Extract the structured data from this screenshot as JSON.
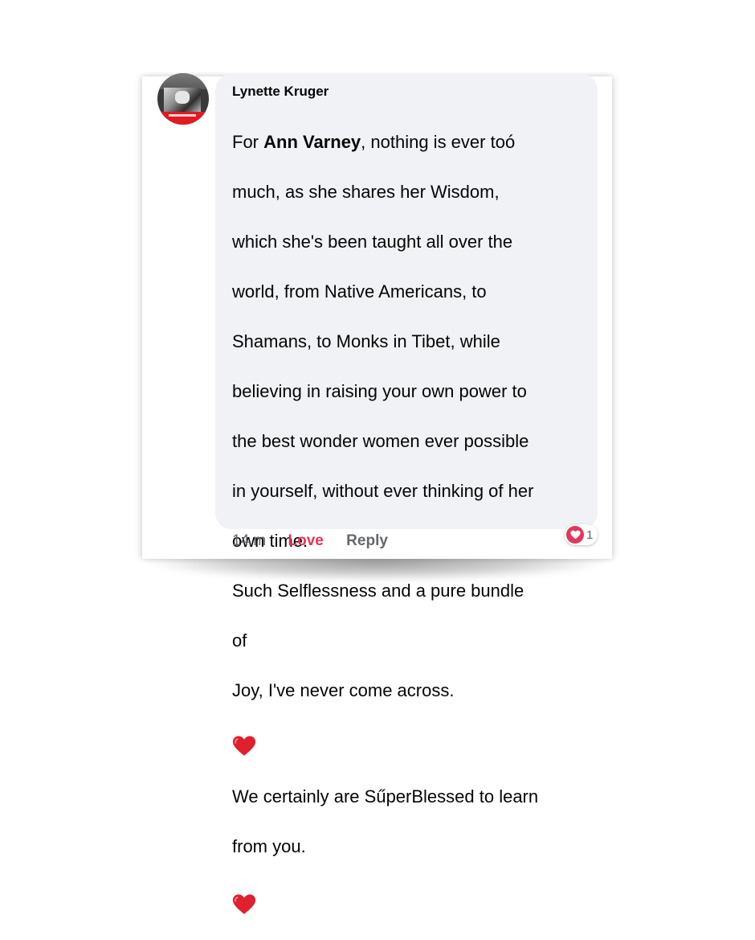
{
  "comment": {
    "author": "Lynette Kruger",
    "lines": [
      {
        "pre": "For ",
        "bold": "Ann Varney",
        "post": ", nothing is ever toó"
      },
      "much, as she shares her Wisdom,",
      "which she's been taught all over the",
      "world, from Native Americans, to",
      "Shamans, to Monks in Tibet, while",
      "believing in raising your own power to",
      "the best wonder women ever possible",
      "in yourself, without ever thinking of her",
      "own time.",
      "Such Selflessness and a pure bundle",
      "of",
      "Joy, I've never come across.",
      "We certainly are SűperBlessed to learn",
      "from you."
    ],
    "emoji": "red-heart"
  },
  "actions": {
    "time": "14 m",
    "love_label": "Love",
    "reply_label": "Reply"
  },
  "reaction": {
    "icon": "heart-reaction-icon",
    "count": "1"
  },
  "colors": {
    "bubble": "#f0f2f5",
    "love": "#e4365a",
    "heart": "#e0202e",
    "muted_text": "#65676b"
  }
}
